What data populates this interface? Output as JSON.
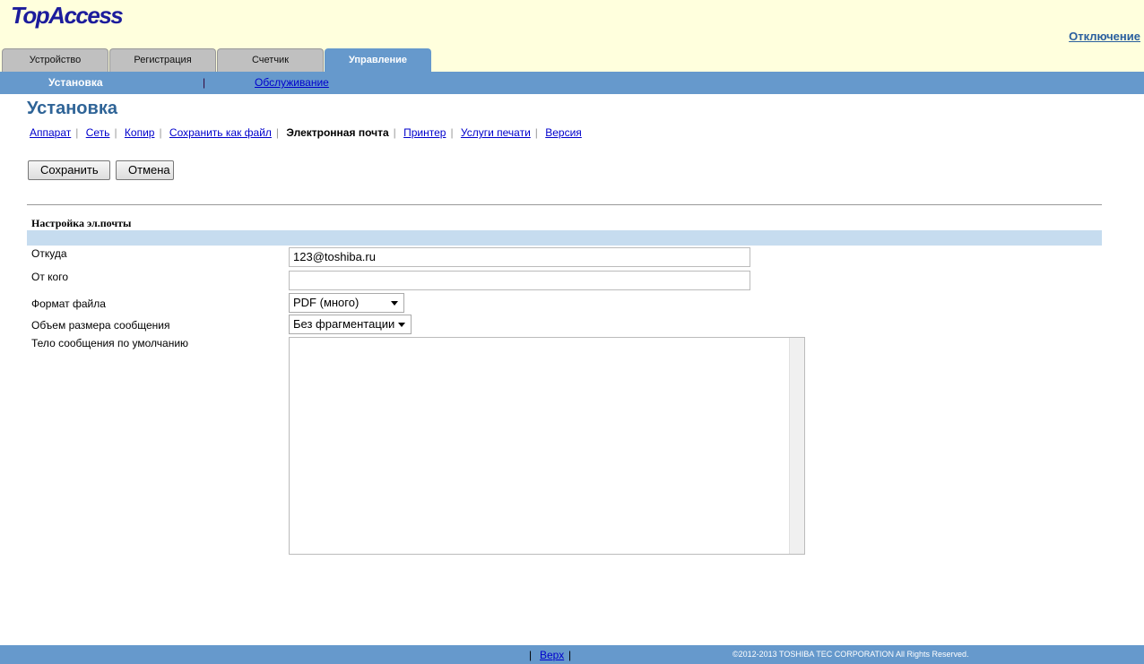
{
  "header": {
    "logo": "TopAccess",
    "logout": "Отключение"
  },
  "tabs": [
    "Устройство",
    "Регистрация",
    "Счетчик",
    "Управление"
  ],
  "subnav": {
    "active": "Установка",
    "sep": "|",
    "other": "Обслуживание"
  },
  "page_title": "Установка",
  "links": [
    "Аппарат",
    "Сеть",
    "Копир",
    "Сохранить как файл",
    "Электронная почта",
    "Принтер",
    "Услуги печати",
    "Версия"
  ],
  "buttons": {
    "save": "Сохранить",
    "cancel": "Отмена"
  },
  "section": "Настройка эл.почты",
  "fields": {
    "from_label": "Откуда",
    "from_value": "123@toshiba.ru",
    "from_name_label": "От кого",
    "from_name_value": "",
    "format_label": "Формат файла",
    "format_value": "PDF (много)",
    "size_label": "Объем размера сообщения",
    "size_value": "Без фрагментации",
    "body_label": "Тело сообщения по умолчанию"
  },
  "footer": {
    "sep1": "|",
    "top": "Верх",
    "sep2": "|",
    "copyright": "©2012-2013 TOSHIBA TEC CORPORATION All Rights Reserved."
  }
}
